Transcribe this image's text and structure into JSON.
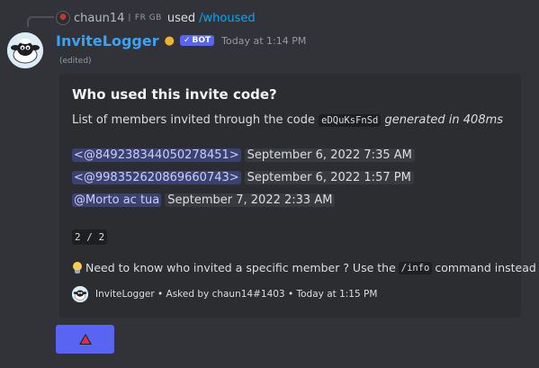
{
  "reply": {
    "username": "chaun14",
    "separator": "|",
    "tag": "FR GB",
    "used": "used",
    "command": "/whoused"
  },
  "message": {
    "bot_name": "InviteLogger",
    "medal_icon": "medal-icon",
    "bot_tag": "BOT",
    "timestamp": "Today at 1:14 PM",
    "edited": "(edited)"
  },
  "embed": {
    "title": "Who used this invite code?",
    "desc_prefix": "List of members invited through the code",
    "code": "eDQuKsFnSd",
    "generated": "generated in 408ms",
    "members": [
      {
        "mention": "<@849238344050278451>",
        "date": "September 6, 2022 7:35 AM"
      },
      {
        "mention": "<@998352620869660743>",
        "date": "September 6, 2022 1:57 PM"
      },
      {
        "mention": "@Morto ac tua",
        "date": "September 7, 2022 2:33 AM"
      }
    ],
    "page": "2 / 2",
    "hint_prefix": "Need to know who invited a specific member ? Use the",
    "hint_command": "/info",
    "hint_suffix": "command instead",
    "footer": "InviteLogger • Asked by chaun14#1403 • Today at 1:15 PM"
  },
  "button": {
    "icon": "up-arrow-icon",
    "color": "#5865f2"
  },
  "colors": {
    "background": "#313338",
    "embed": "#2b2d31",
    "bot_name": "#3ba2f7",
    "mention_bg": "#3c4270",
    "link": "#00a8fc"
  }
}
